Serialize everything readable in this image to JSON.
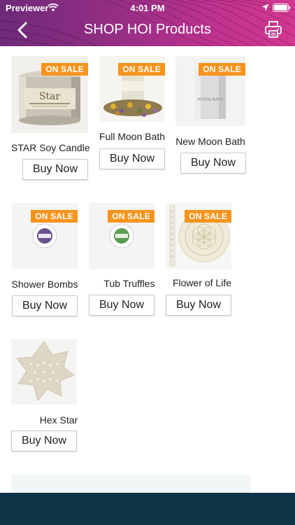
{
  "status_bar": {
    "carrier": "Previewer",
    "time": "4:01 PM",
    "icons": [
      "wifi-icon",
      "location-icon",
      "battery-icon"
    ]
  },
  "header": {
    "title": "SHOP HOI Products",
    "back_icon": "chevron-left-icon",
    "print_icon": "printer-icon"
  },
  "colors": {
    "header_start": "#6d2a78",
    "header_end": "#d2378f",
    "sale_badge": "#f7941d",
    "bottom_bar": "#0e3448"
  },
  "products": [
    {
      "name": "STAR Soy Candle",
      "badge": "ON SALE",
      "button": "Buy Now",
      "label_text": "Star"
    },
    {
      "name": "Full Moon Bath",
      "badge": "ON SALE",
      "button": "Buy Now"
    },
    {
      "name": "New Moon Bath",
      "badge": "ON SALE",
      "button": "Buy Now",
      "label_text": "MOON BATH"
    },
    {
      "name": "Shower Bombs",
      "badge": "ON SALE",
      "button": "Buy Now"
    },
    {
      "name": "Tub Truffles",
      "badge": "ON SALE",
      "button": "Buy Now"
    },
    {
      "name": "Flower of Life",
      "badge": "ON SALE",
      "button": "Buy Now"
    },
    {
      "name": "Hex Star",
      "button": "Buy Now"
    }
  ]
}
